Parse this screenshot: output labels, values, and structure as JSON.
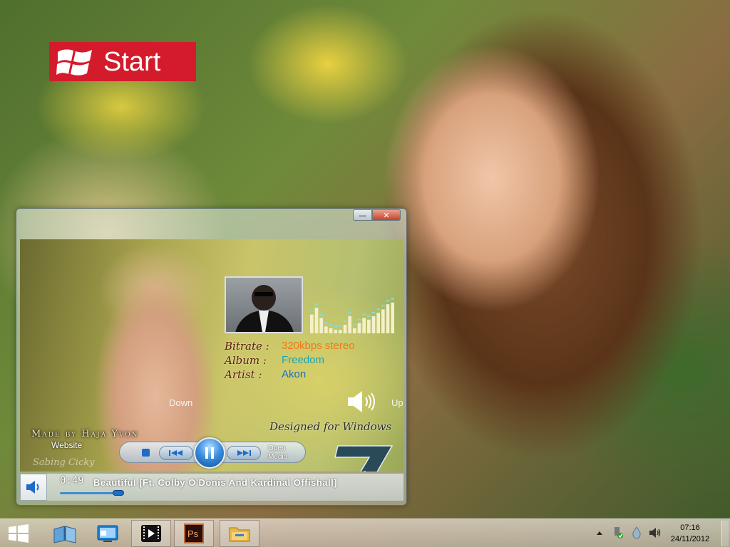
{
  "start_tile": {
    "label": "Start"
  },
  "player": {
    "info": {
      "bitrate_label": "Bitrate :",
      "bitrate_value": "320kbps stereo",
      "album_label": "Album :",
      "album_value": "Freedom",
      "artist_label": "Artist :",
      "artist_value": "Akon"
    },
    "volume_down_label": "Down",
    "volume_up_label": "Up",
    "made_by": "Made by Haja Yvon",
    "website_label": "Website",
    "signature": "Sabing Cicky",
    "designed_for": "Designed for Windows",
    "open_media_line1": "Open",
    "open_media_line2": "Media",
    "time": "0:49",
    "track_title": "Beautiful [Ft. Colby O'Donis And Kardinal Offishall]",
    "seek_progress": 0.24,
    "equalizer_levels": [
      0.55,
      0.75,
      0.45,
      0.2,
      0.15,
      0.1,
      0.1,
      0.25,
      0.5,
      0.15,
      0.3,
      0.45,
      0.4,
      0.5,
      0.6,
      0.7,
      0.85,
      0.9
    ]
  },
  "taskbar": {
    "clock_time": "07:16",
    "clock_date": "24/11/2012"
  },
  "colors": {
    "start_tile": "#d31b2c",
    "bitrate": "#f07a1a",
    "album": "#1aa5b5",
    "artist": "#1a6fc4",
    "accent_blue": "#1e6bc9"
  }
}
